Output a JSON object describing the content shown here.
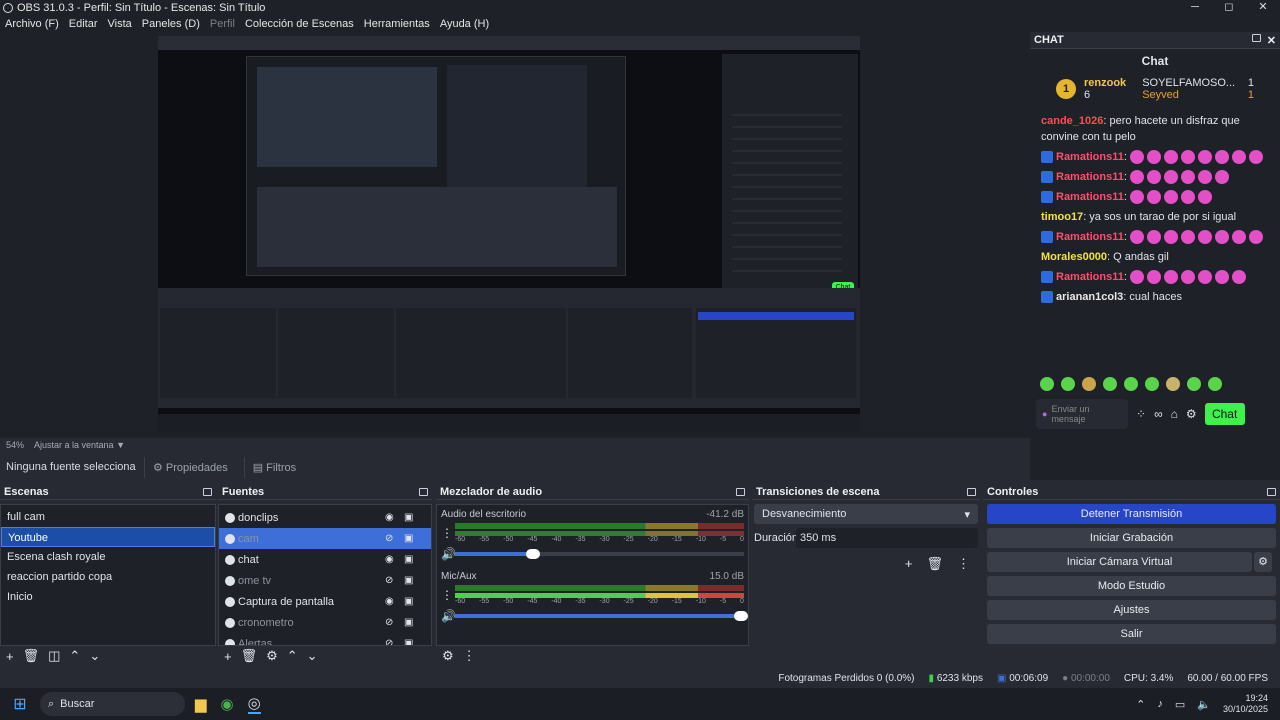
{
  "titlebar": {
    "title": "OBS 31.0.3 - Perfil: Sin Título - Escenas: Sin Título",
    "min": "─",
    "max": "◻",
    "close": "✕"
  },
  "menu": [
    "Archivo (F)",
    "Editar",
    "Vista",
    "Paneles (D)",
    "Perfil",
    "Colección de Escenas",
    "Herramientas",
    "Ayuda (H)"
  ],
  "preview": {
    "zoom": "54%",
    "fit_label": "Ajustar a la ventana"
  },
  "sourcebar": {
    "selected": "Ninguna fuente seleccionada",
    "properties": "Propiedades",
    "filters": "Filtros"
  },
  "scenes": {
    "title": "Escenas",
    "items": [
      "full cam",
      "Youtube",
      "Escena clash royale",
      "reaccion partido copa",
      "Inicio"
    ],
    "selected": 1
  },
  "sources": {
    "title": "Fuentes",
    "items": [
      {
        "name": "donclips",
        "dim": false,
        "sel": false
      },
      {
        "name": "cam",
        "dim": true,
        "sel": true
      },
      {
        "name": "chat",
        "dim": false,
        "sel": false
      },
      {
        "name": "ome tv",
        "dim": true,
        "sel": false
      },
      {
        "name": "Captura de pantalla",
        "dim": false,
        "sel": false
      },
      {
        "name": "cronometro",
        "dim": true,
        "sel": false
      },
      {
        "name": "Alertas",
        "dim": true,
        "sel": false
      }
    ]
  },
  "mixer": {
    "title": "Mezclador de audio",
    "channels": [
      {
        "name": "Audio del escritorio",
        "db": "-41.2 dB",
        "volume": 0.27
      },
      {
        "name": "Mic/Aux",
        "db": "15.0 dB",
        "volume": 0.99
      }
    ],
    "scale": [
      "-60",
      "-55",
      "-50",
      "-45",
      "-40",
      "-35",
      "-30",
      "-25",
      "-20",
      "-15",
      "-10",
      "-5",
      "0"
    ]
  },
  "transitions": {
    "title": "Transiciones de escena",
    "selected": "Desvanecimiento",
    "duration_label": "Duración",
    "duration": "350 ms"
  },
  "controls": {
    "title": "Controles",
    "buttons": [
      "Detener Transmisión",
      "Iniciar Grabación",
      "Iniciar Cámara Virtual",
      "Modo Estudio",
      "Ajustes",
      "Salir"
    ]
  },
  "chat": {
    "dock_title": "CHAT",
    "title": "Chat",
    "leader": {
      "rank": "1",
      "name": "renzook",
      "count": "6"
    },
    "leaders2": [
      {
        "name": "SOYELFAMOSO...",
        "count": "1"
      },
      {
        "name": "Seyved",
        "count": "1"
      }
    ],
    "messages": [
      {
        "user": "cande_1026",
        "text": ": pero hacete un disfraz que convine con tu pelo",
        "color": "#ff4d4d",
        "emotes": 0
      },
      {
        "user": "Ramations11",
        "text": ":",
        "color": "#ff4d6a",
        "emotes": 8
      },
      {
        "user": "Ramations11",
        "text": ":",
        "color": "#ff4d6a",
        "emotes": 6
      },
      {
        "user": "Ramations11",
        "text": ":",
        "color": "#ff4d6a",
        "emotes": 5
      },
      {
        "user": "timoo17",
        "text": ": ya sos un tarao de por si igual",
        "color": "#f6e23c",
        "emotes": 0
      },
      {
        "user": "Ramations11",
        "text": ":",
        "color": "#ff4d6a",
        "emotes": 8
      },
      {
        "user": "Morales0000",
        "text": ": Q andas gil",
        "color": "#f6e23c",
        "emotes": 0
      },
      {
        "user": "Ramations11",
        "text": ":",
        "color": "#ff4d6a",
        "emotes": 7
      },
      {
        "user": "arianan1col3",
        "text": ": cual haces",
        "color": "#e8e8e8",
        "emotes": 0
      }
    ],
    "placeholder": "Enviar un mensaje",
    "send": "Chat"
  },
  "status": {
    "dropped": "Fotogramas Perdidos 0 (0.0%)",
    "bitrate": "6233 kbps",
    "stream_time": "00:06:09",
    "rec_time": "00:00:00",
    "cpu": "CPU: 3.4%",
    "fps": "60.00 / 60.00 FPS"
  },
  "taskbar": {
    "search": "Buscar",
    "time": "19:24",
    "date": "30/10/2025"
  }
}
